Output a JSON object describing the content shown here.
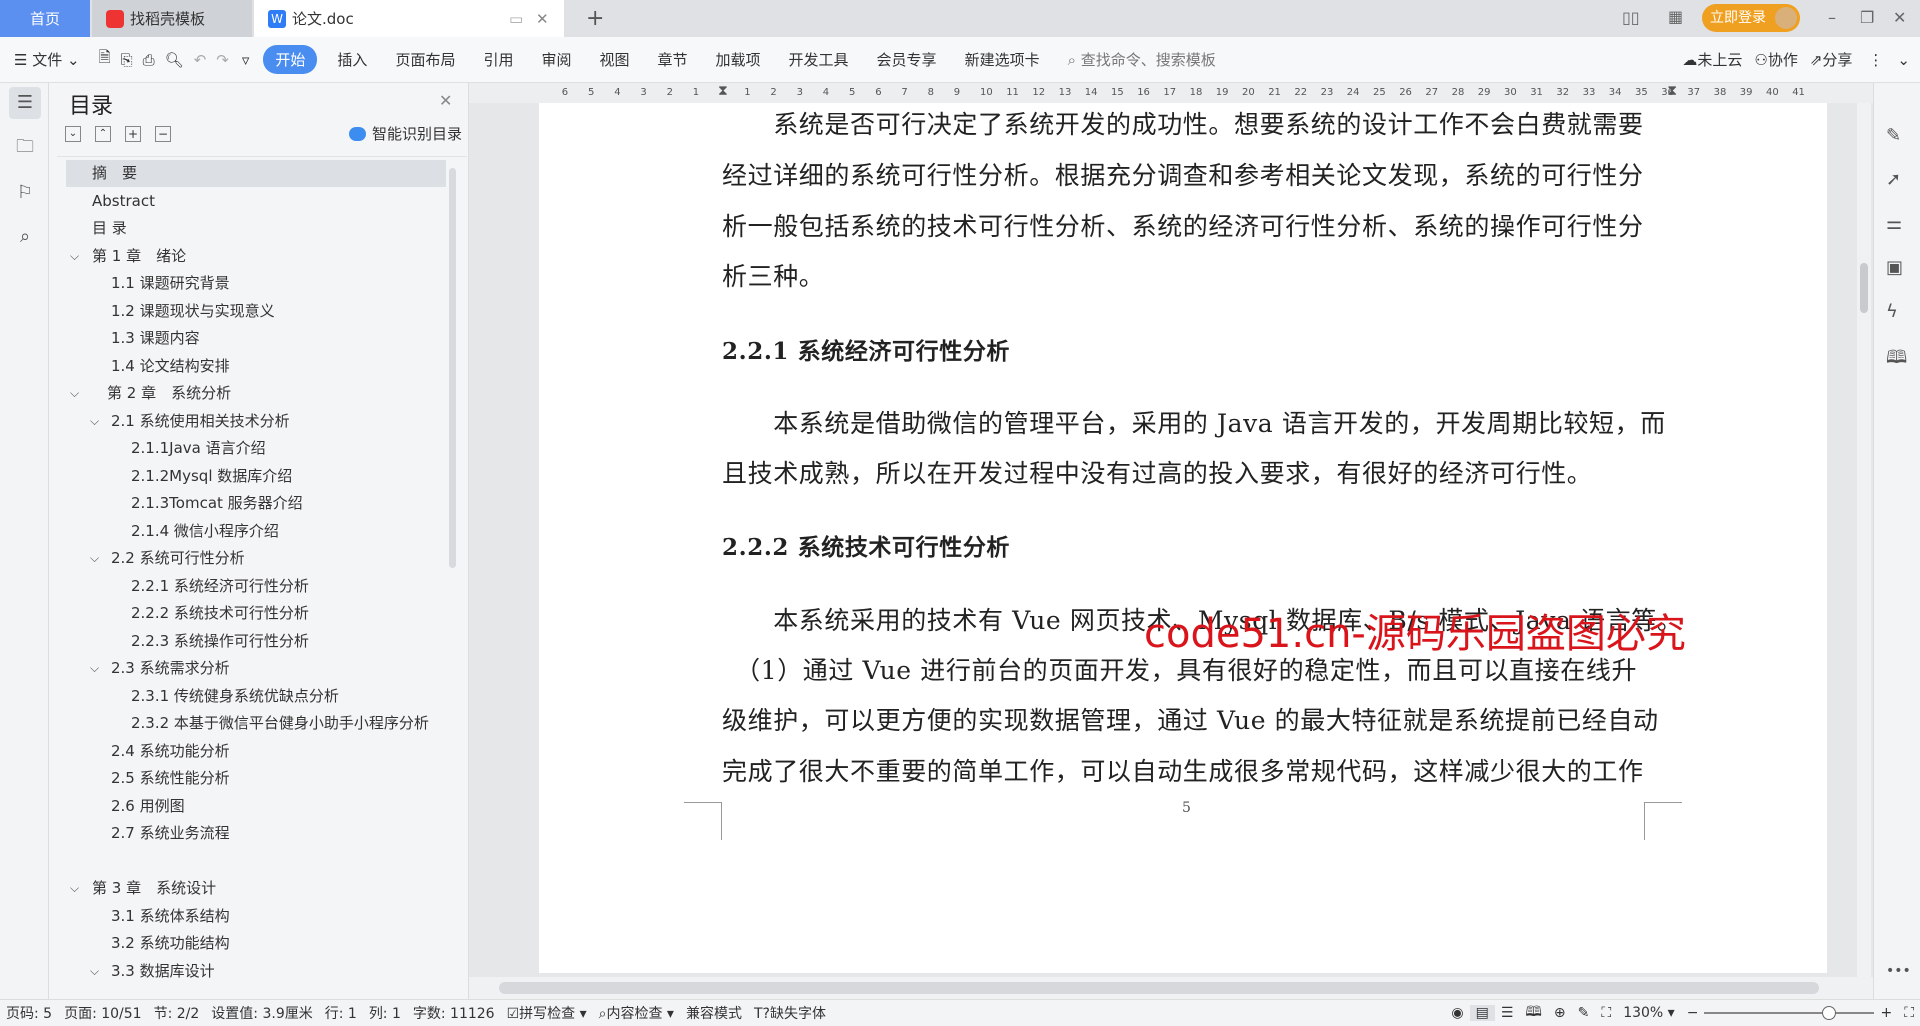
{
  "tabs": {
    "home": "首页",
    "template": "找稻壳模板",
    "doc": "论文.doc",
    "new_tab": "+"
  },
  "window": {
    "login": "立即登录",
    "min": "–",
    "restore": "❐",
    "close": "✕"
  },
  "toolbar": {
    "file": "文件",
    "menus": [
      "开始",
      "插入",
      "页面布局",
      "引用",
      "审阅",
      "视图",
      "章节",
      "加载项",
      "开发工具",
      "会员专享",
      "新建选项卡"
    ],
    "search_placeholder": "查找命令、搜索模板",
    "cloud": "未上云",
    "collab": "协作",
    "share": "分享"
  },
  "toc": {
    "title": "目录",
    "smart": "智能识别目录",
    "items": [
      {
        "label": "摘　要",
        "level": 0,
        "selected": true
      },
      {
        "label": "Abstract",
        "level": 0
      },
      {
        "label": "目  录",
        "level": 0
      },
      {
        "label": "第 1 章　绪论",
        "level": 0,
        "chevron": true
      },
      {
        "label": "1.1 课题研究背景",
        "level": 1
      },
      {
        "label": "1.2 课题现状与实现意义",
        "level": 1
      },
      {
        "label": "1.3 课题内容",
        "level": 1
      },
      {
        "label": "1.4 论文结构安排",
        "level": 1
      },
      {
        "label": "第 2 章　系统分析",
        "level": 0,
        "chevron": true,
        "extra": true
      },
      {
        "label": "2.1 系统使用相关技术分析",
        "level": 1,
        "chevron": true
      },
      {
        "label": "2.1.1Java 语言介绍",
        "level": 2
      },
      {
        "label": "2.1.2Mysql 数据库介绍",
        "level": 2
      },
      {
        "label": "2.1.3Tomcat 服务器介绍",
        "level": 2
      },
      {
        "label": "2.1.4 微信小程序介绍",
        "level": 2
      },
      {
        "label": "2.2 系统可行性分析",
        "level": 1,
        "chevron": true
      },
      {
        "label": "2.2.1 系统经济可行性分析",
        "level": 2
      },
      {
        "label": "2.2.2 系统技术可行性分析",
        "level": 2
      },
      {
        "label": "2.2.3 系统操作可行性分析",
        "level": 2
      },
      {
        "label": "2.3 系统需求分析",
        "level": 1,
        "chevron": true
      },
      {
        "label": "2.3.1 传统健身系统优缺点分析",
        "level": 2
      },
      {
        "label": "2.3.2 本基于微信平台健身小助手小程序分析",
        "level": 2
      },
      {
        "label": "2.4 系统功能分析",
        "level": 1
      },
      {
        "label": "2.5 系统性能分析",
        "level": 1
      },
      {
        "label": "2.6 用例图",
        "level": 1
      },
      {
        "label": "2.7 系统业务流程",
        "level": 1
      },
      {
        "label": "",
        "level": 0
      },
      {
        "label": "第 3 章　系统设计",
        "level": 0,
        "chevron": true
      },
      {
        "label": "3.1 系统体系结构",
        "level": 1
      },
      {
        "label": "3.2 系统功能结构",
        "level": 1
      },
      {
        "label": "3.3 数据库设计",
        "level": 1,
        "chevron": true
      }
    ]
  },
  "ruler": {
    "left": [
      "6",
      "5",
      "4",
      "3",
      "2",
      "1"
    ],
    "right": [
      "1",
      "2",
      "3",
      "4",
      "5",
      "6",
      "7",
      "8",
      "9",
      "10",
      "11",
      "12",
      "13",
      "14",
      "15",
      "16",
      "17",
      "18",
      "19",
      "20",
      "21",
      "22",
      "23",
      "24",
      "25",
      "26",
      "27",
      "28",
      "29",
      "30",
      "31",
      "32",
      "33",
      "34",
      "35",
      "36",
      "37",
      "38",
      "39",
      "40",
      "41"
    ]
  },
  "document": {
    "lines": [
      {
        "text": "　　系统是否可行决定了系统开发的成功性。想要系统的设计工作不会白费就需要"
      },
      {
        "text": "经过详细的系统可行性分析。根据充分调查和参考相关论文发现，系统的可行性分"
      },
      {
        "text": "析一般包括系统的技术可行性分析、系统的经济可行性分析、系统的操作可行性分"
      },
      {
        "text": "析三种。"
      },
      {
        "text": "2.2.1 系统经济可行性分析",
        "heading": true
      },
      {
        "text": "　　本系统是借助微信的管理平台，采用的 Java 语言开发的，开发周期比较短，而"
      },
      {
        "text": "且技术成熟，所以在开发过程中没有过高的投入要求，有很好的经济可行性。"
      },
      {
        "text": "2.2.2 系统技术可行性分析",
        "heading": true
      },
      {
        "text": "　　本系统采用的技术有 Vue 网页技术、Mysql 数据库、B/s 模式、Java 语言等。"
      },
      {
        "text": "　（1）通过 Vue 进行前台的页面开发，具有很好的稳定性，而且可以直接在线升"
      },
      {
        "text": "级维护，可以更方便的实现数据管理，通过 Vue 的最大特征就是系统提前已经自动"
      },
      {
        "text": "完成了很大不重要的简单工作，可以自动生成很多常规代码，这样减少很大的工作"
      }
    ],
    "page_number": "5",
    "watermark": "code51.cn-源码乐园盗图必究"
  },
  "status": {
    "page": "页码: 5",
    "pages": "页面: 10/51",
    "section": "节: 2/2",
    "setting": "设置值: 3.9厘米",
    "row": "行: 1",
    "col": "列: 1",
    "words": "字数: 11126",
    "spell": "拼写检查",
    "content": "内容检查",
    "compat": "兼容模式",
    "font": "缺失字体",
    "zoom": "130%"
  },
  "colors": {
    "accent": "#4a8df0",
    "login": "#f0a020",
    "watermark": "#d9141b"
  }
}
